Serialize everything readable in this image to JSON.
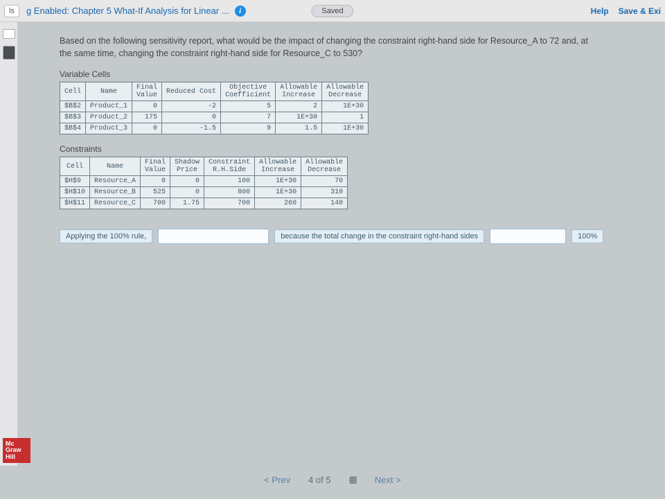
{
  "topbar": {
    "ls": "ls",
    "title": "g Enabled: Chapter 5 What-If Analysis for Linear ...",
    "info_glyph": "i",
    "saved": "Saved",
    "help": "Help",
    "save_exit": "Save & Exi"
  },
  "question_text": "Based on the following sensitivity report, what would be the impact of changing the constraint right-hand side for Resource_A to 72 and, at the same time, changing the constraint right-hand side for Resource_C to 530?",
  "var_section": "Variable Cells",
  "var_headers": {
    "cell": "Cell",
    "name": "Name",
    "final": "Final\nValue",
    "reduced": "Reduced Cost",
    "obj": "Objective\nCoefficient",
    "inc": "Allowable\nIncrease",
    "dec": "Allowable\nDecrease"
  },
  "var_rows": [
    {
      "cell": "$B$2",
      "name": "Product_1",
      "final": "0",
      "reduced": "-2",
      "obj": "5",
      "inc": "2",
      "dec": "1E+30"
    },
    {
      "cell": "$B$3",
      "name": "Product_2",
      "final": "175",
      "reduced": "0",
      "obj": "7",
      "inc": "1E+30",
      "dec": "1"
    },
    {
      "cell": "$B$4",
      "name": "Product_3",
      "final": "0",
      "reduced": "-1.5",
      "obj": "9",
      "inc": "1.5",
      "dec": "1E+30"
    }
  ],
  "con_section": "Constraints",
  "con_headers": {
    "cell": "Cell",
    "name": "Name",
    "final": "Final\nValue",
    "shadow": "Shadow\nPrice",
    "rhs": "Constraint\nR.H.Side",
    "inc": "Allowable\nIncrease",
    "dec": "Allowable\nDecrease"
  },
  "con_rows": [
    {
      "cell": "$H$9",
      "name": "Resource_A",
      "final": "0",
      "shadow": "0",
      "rhs": "100",
      "inc": "1E+30",
      "dec": "70"
    },
    {
      "cell": "$H$10",
      "name": "Resource_B",
      "final": "525",
      "shadow": "0",
      "rhs": "800",
      "inc": "1E+30",
      "dec": "310"
    },
    {
      "cell": "$H$11",
      "name": "Resource_C",
      "final": "700",
      "shadow": "1.75",
      "rhs": "700",
      "inc": "260",
      "dec": "140"
    }
  ],
  "answer": {
    "prefix": "Applying the 100% rule,",
    "middle": "because the total change in the constraint right-hand sides",
    "end": "100%"
  },
  "pager": {
    "prev": "<  Prev",
    "pos": "4  of  5",
    "next": "Next  >"
  },
  "brand": "Mc\nGraw\nHill"
}
